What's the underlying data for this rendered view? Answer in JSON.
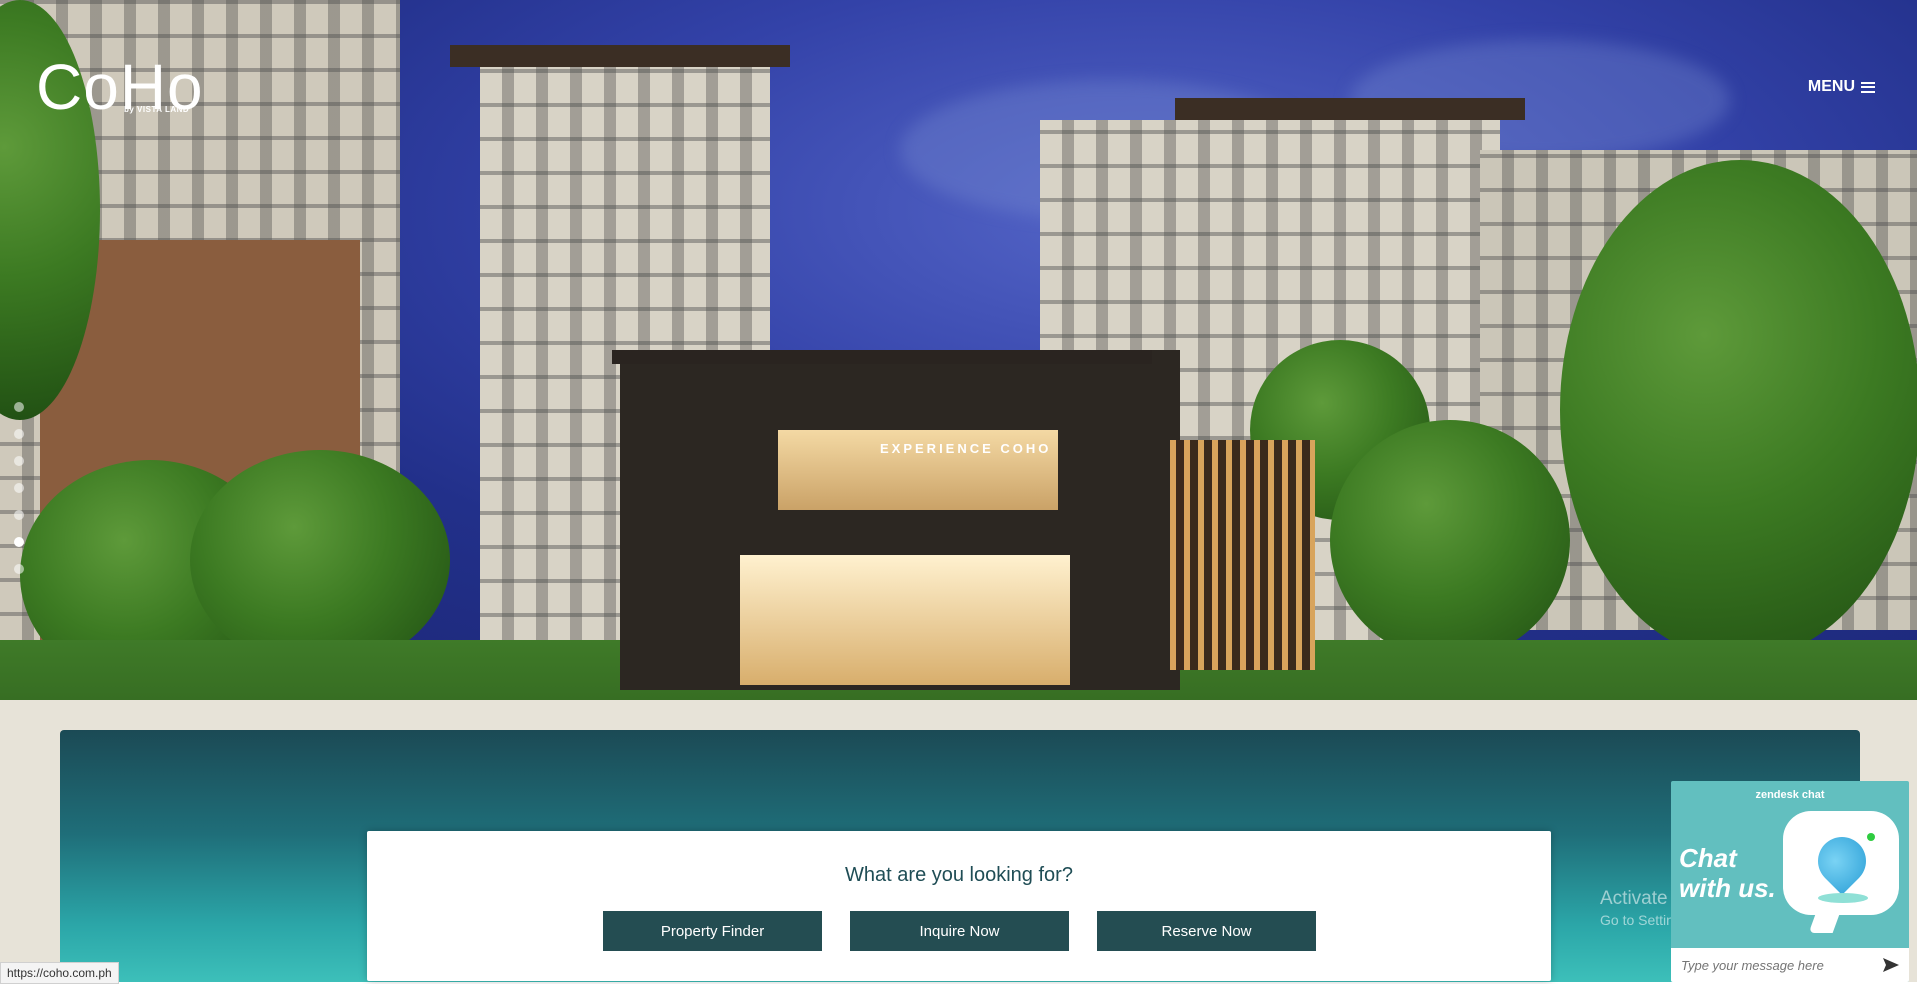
{
  "header": {
    "logo_text": "CoHo",
    "logo_sub": "by VISTA LAND",
    "menu_label": "MENU"
  },
  "hero": {
    "caption": "EXPERIENCE COHO",
    "slide_count": 7,
    "active_slide": 6
  },
  "finder": {
    "title": "What are you looking for?",
    "buttons": [
      {
        "label": "Property Finder"
      },
      {
        "label": "Inquire Now"
      },
      {
        "label": "Reserve Now"
      }
    ]
  },
  "status_bar": {
    "url": "https://coho.com.ph"
  },
  "watermark": {
    "line1": "Activate Windows",
    "line2": "Go to Settings to activate Windows."
  },
  "chat": {
    "brand": "zendesk chat",
    "headline_line1": "Chat",
    "headline_line2": "with us.",
    "input_placeholder": "Type your message here"
  },
  "colors": {
    "accent": "#244d52",
    "finder_title": "#1f4d55",
    "chat_bg": "#62bfbf"
  }
}
